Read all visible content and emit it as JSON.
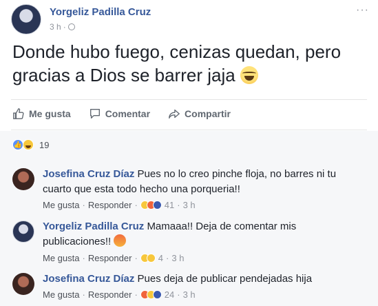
{
  "post": {
    "author": "Yorgeliz Padilla Cruz",
    "time": "3 h",
    "text": "Donde hubo fuego, cenizas quedan, pero gracias a Dios se barrer jaja",
    "more_icon": "ellipsis-icon"
  },
  "actions": {
    "like": "Me gusta",
    "comment": "Comentar",
    "share": "Compartir"
  },
  "reactions": {
    "count": "19",
    "types": [
      "like",
      "haha"
    ]
  },
  "comments": [
    {
      "author": "Josefina Cruz Díaz",
      "text": "Pues no lo creo pinche floja, no barres ni tu cuarto que esta todo hecho una porqueria!!",
      "like": "Me gusta",
      "reply": "Responder",
      "reactions_count": "41",
      "time": "3 h"
    },
    {
      "author": "Yorgeliz Padilla Cruz",
      "text": "Mamaaa!! Deja de comentar mis publicaciones!!",
      "like": "Me gusta",
      "reply": "Responder",
      "reactions_count": "4",
      "time": "3 h"
    },
    {
      "author": "Josefina Cruz Díaz",
      "text": "Pues deja de publicar pendejadas hija",
      "like": "Me gusta",
      "reply": "Responder",
      "reactions_count": "24",
      "time": "3 h"
    }
  ],
  "colors": {
    "link": "#365899",
    "muted": "#90949c",
    "background": "#f6f7f9"
  }
}
